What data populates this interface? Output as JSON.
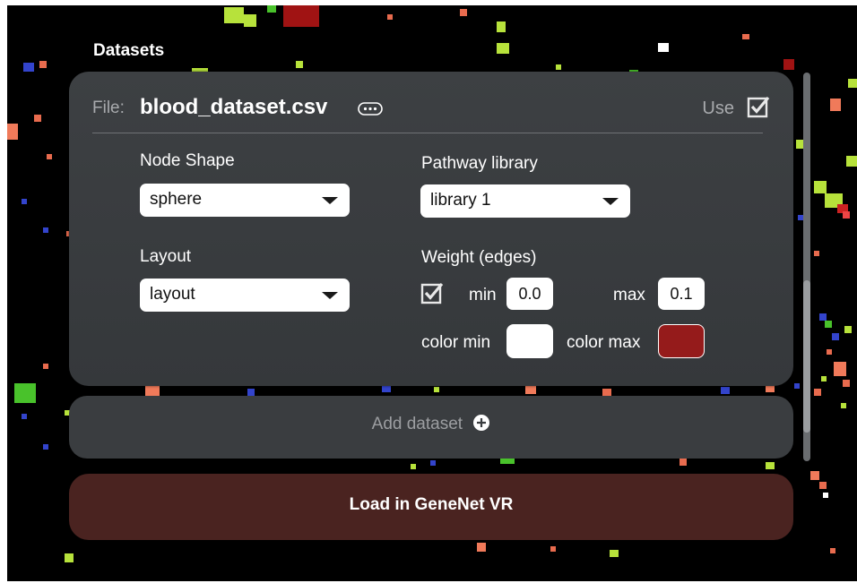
{
  "section": {
    "title": "Datasets"
  },
  "dataset": {
    "file_label": "File:",
    "file_name": "blood_dataset.csv",
    "more_icon": "ellipsis-circle-icon",
    "use_label": "Use",
    "use_checked": true,
    "node_shape": {
      "label": "Node Shape",
      "value": "sphere"
    },
    "pathway_library": {
      "label": "Pathway library",
      "value": "library 1"
    },
    "layout": {
      "label": "Layout",
      "value": "layout"
    },
    "weight": {
      "label": "Weight (edges)",
      "enabled": true,
      "min_label": "min",
      "min_value": "0.0",
      "max_label": "max",
      "max_value": "0.1",
      "color_min_label": "color min",
      "color_min_value": "#ffffff",
      "color_max_label": "color max",
      "color_max_value": "#951b1b"
    }
  },
  "add_dataset": {
    "label": "Add dataset",
    "icon": "plus-circle-icon"
  },
  "load_button": {
    "label": "Load in GeneNet VR"
  },
  "colors": {
    "background": "#000000",
    "card": "#3b3e41",
    "load_button": "#4a2320",
    "accent_red": "#951b1b"
  }
}
